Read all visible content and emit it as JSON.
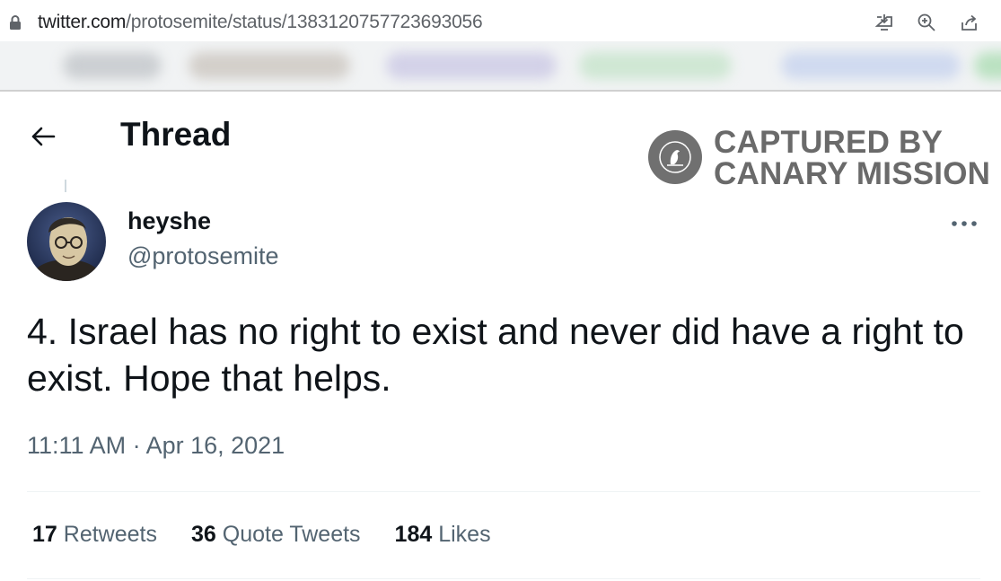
{
  "browser": {
    "url_host": "twitter.com",
    "url_path": "/protosemite/status/1383120757723693056"
  },
  "header": {
    "title": "Thread"
  },
  "watermark": {
    "line1": "CAPTURED BY",
    "line2": "CANARY MISSION"
  },
  "tweet": {
    "display_name": "heyshe",
    "handle": "@protosemite",
    "text": "4. Israel has no right to exist and never did have a right to exist. Hope that helps.",
    "timestamp": "11:11 AM · Apr 16, 2021"
  },
  "stats": {
    "retweets_count": "17",
    "retweets_label": "Retweets",
    "quotes_count": "36",
    "quotes_label": "Quote Tweets",
    "likes_count": "184",
    "likes_label": "Likes"
  },
  "icons": {
    "lock": "lock-icon",
    "install": "install-icon",
    "zoom": "zoom-icon",
    "share": "share-icon",
    "back": "arrow-left-icon",
    "more": "more-horizontal-icon",
    "canary": "canary-bird-icon"
  },
  "colors": {
    "text_primary": "#0f1419",
    "text_secondary": "#536471",
    "watermark": "#6a6a6a"
  }
}
